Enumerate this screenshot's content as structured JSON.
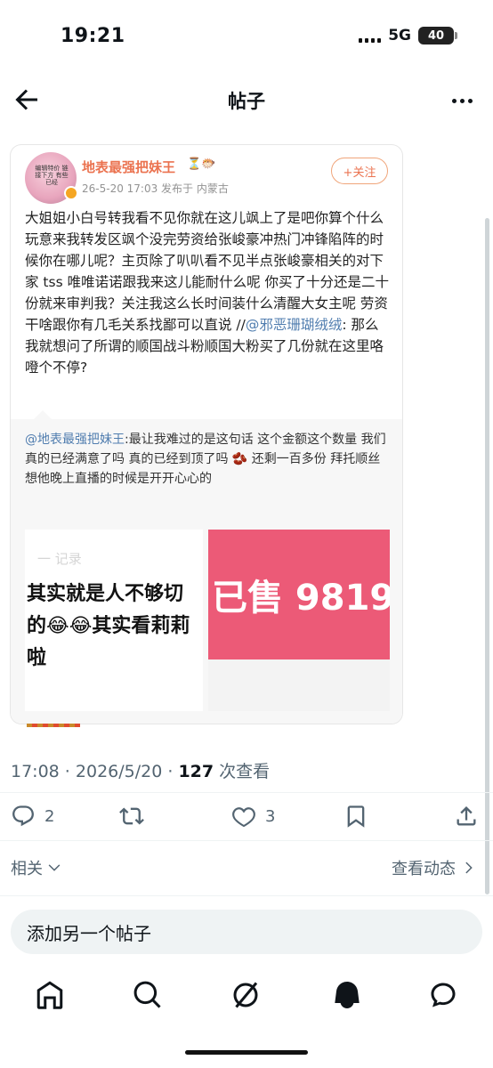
{
  "status_bar": {
    "time": "19:21",
    "network": "5G",
    "battery": "40"
  },
  "header": {
    "title": "帖子"
  },
  "embedded": {
    "author": "地表最强把妹王",
    "author_badges": "⏳🐡",
    "avatar_text": "编辑特价 链接下方 有些已经",
    "meta": "26-5-20 17:03  发布于 内蒙古",
    "follow_label": "+关注",
    "body_before": "大姐姐小白号转我看不见你就在这儿飒上了是吧你算个什么玩意来我转发区飒个没完劳资给张峻豪冲热门冲锋陷阵的时候你在哪儿呢？主页除了叭叭看不见半点张峻豪相关的对下家 tss 唯唯诺诺跟我来这儿能耐什么呢 你买了十分还是二十份就来审判我？关注我这么长时间装什么清醒大女主呢 劳资干啥跟你有几毛关系找鄙可以直说 //",
    "body_mention": "@邪恶珊瑚绒绒",
    "body_after": ": 那么我就想问了所谓的顺国战斗粉顺国大粉买了几份就在这里咯噔个不停?",
    "quote_mention": "@地表最强把妹王",
    "quote_text": ":最让我难过的是这句话 这个金额这个数量 我们真的已经满意了吗 真的已经到顶了吗 🫘 还剩一百多份 拜托顺丝 想他晚上直播的时候是开开心心的",
    "image_left_faint": "一 记录",
    "image_left_text": "其实就是人不够切\n的😂😂其实看莉莉\n啦",
    "image_right_text": "已售 9819"
  },
  "tweet": {
    "time": "17:08",
    "date": "2026/5/20",
    "views": "127",
    "views_label": "次查看",
    "replies": "2",
    "likes": "3"
  },
  "related_label": "相关",
  "activity_label": "查看动态",
  "add_post_placeholder": "添加另一个帖子",
  "colors": {
    "accent": "#eb7350",
    "link": "#507daf",
    "pink": "#ec5a77"
  }
}
